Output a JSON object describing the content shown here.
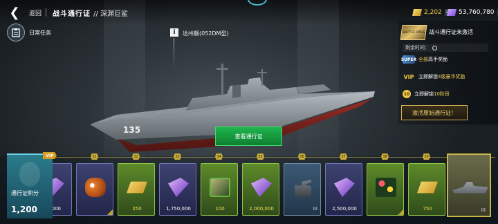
{
  "header": {
    "back_label": "返回",
    "title": "战斗通行证",
    "subtitle": "// 深渊巨鲨"
  },
  "currencies": [
    {
      "name": "gold",
      "value": "2,202",
      "color": "#f5c94a"
    },
    {
      "name": "gems",
      "value": "53,760,780",
      "color": "#ffffff"
    }
  ],
  "daily_tasks": {
    "label": "日常任务"
  },
  "ship": {
    "name": "达州舰(052DM型)",
    "hull_number": "135"
  },
  "upgrade_button": {
    "label": "查看通行证"
  },
  "right_panel": {
    "pass_thumb_text": "BATTLE PASS",
    "status": "战斗通行证未激活",
    "remaining_label": "剩余时间：",
    "perks": [
      {
        "badge": "SUPER",
        "prefix": "",
        "highlight": "",
        "text": "全部",
        "rest": "高手奖励"
      },
      {
        "badge": "VIP",
        "prefix": "立即解锁",
        "highlight": "4级豪华奖励",
        "text": "",
        "rest": ""
      },
      {
        "badge": "10",
        "prefix": "立即解锁",
        "highlight": "10阶段",
        "text": "",
        "rest": ""
      }
    ],
    "activate_label": "激活原始通行证！"
  },
  "score": {
    "label": "通行证积分",
    "value": "1,200"
  },
  "vip_tag": "VIP",
  "levels": [
    "31",
    "32",
    "33",
    "34",
    "35",
    "36",
    "37",
    "38",
    "39"
  ],
  "rewards": [
    {
      "type": "chips",
      "tier": "purple",
      "amount": "0,000"
    },
    {
      "type": "panda",
      "tier": "purple",
      "amount": ""
    },
    {
      "type": "gold",
      "tier": "green",
      "amount": "250"
    },
    {
      "type": "chips",
      "tier": "purple",
      "amount": "1,750,000"
    },
    {
      "type": "chest",
      "tier": "green",
      "amount": "100"
    },
    {
      "type": "chips",
      "tier": "green",
      "amount": "2,000,000"
    },
    {
      "type": "turret",
      "tier": "blue",
      "amount": "",
      "roman": "III"
    },
    {
      "type": "chips",
      "tier": "purple",
      "amount": "2,500,000"
    },
    {
      "type": "flowers",
      "tier": "green",
      "amount": ""
    },
    {
      "type": "gold",
      "tier": "green",
      "amount": "750"
    }
  ],
  "final_reward": {
    "type": "ship",
    "roman": "III"
  }
}
